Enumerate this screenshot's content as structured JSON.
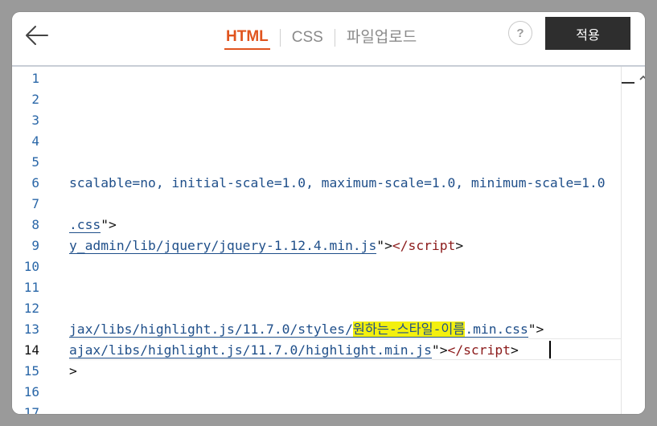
{
  "header": {
    "back_icon": "arrow-left-icon",
    "tabs": [
      {
        "label": "HTML",
        "active": true
      },
      {
        "label": "CSS",
        "active": false
      },
      {
        "label": "파일업로드",
        "active": false
      }
    ],
    "help_label": "?",
    "apply_label": "적용"
  },
  "editor": {
    "active_line": "14",
    "line_numbers": [
      "1",
      "2",
      "3",
      "4",
      "5",
      "6",
      "7",
      "8",
      "9",
      "10",
      "11",
      "12",
      "13",
      "14",
      "15",
      "16",
      "17"
    ],
    "lines": {
      "l6": "scalable=no, initial-scale=1.0, maximum-scale=1.0, minimum-scale=1.0",
      "l8_link": ".css",
      "l8_tail": "\">",
      "l9_link": "y_admin/lib/jquery/jquery-1.12.4.min.js",
      "l9_q": "\">",
      "l9_tag": "</script",
      "l9_end": ">",
      "l13_a": "jax/libs/highlight.js/11.7.0/styles/",
      "l13_hl": "원하는-스타일-이름",
      "l13_b": ".min.css",
      "l13_end": "\">",
      "l14_link": "ajax/libs/highlight.js/11.7.0/highlight.min.js",
      "l14_q": "\">",
      "l14_tag": "</script",
      "l14_end": ">",
      "l15": ">"
    }
  },
  "colors": {
    "accent": "#e0541e",
    "link": "#1f4f8a",
    "tag": "#8b1a1a",
    "highlight": "#f3f00e",
    "apply_button": "#2e2e2e"
  }
}
